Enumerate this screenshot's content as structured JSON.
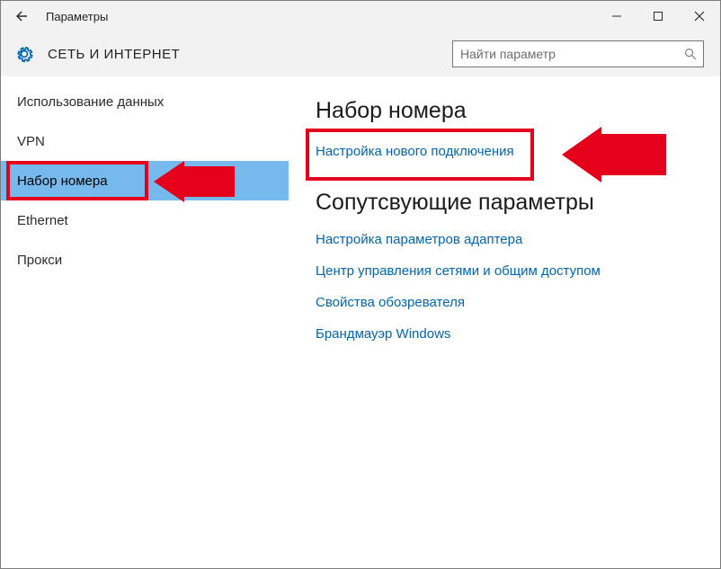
{
  "window": {
    "title": "Параметры"
  },
  "header": {
    "page_name": "СЕТЬ И ИНТЕРНЕТ",
    "search_placeholder": "Найти параметр"
  },
  "sidebar": {
    "items": [
      {
        "label": "Использование данных",
        "selected": false
      },
      {
        "label": "VPN",
        "selected": false
      },
      {
        "label": "Набор номера",
        "selected": true
      },
      {
        "label": "Ethernet",
        "selected": false
      },
      {
        "label": "Прокси",
        "selected": false
      }
    ]
  },
  "content": {
    "heading": "Набор номера",
    "primary_link": "Настройка нового подключения",
    "related_heading": "Сопутсвующие параметры",
    "related_links": [
      "Настройка параметров адаптера",
      "Центр управления сетями и общим доступом",
      "Свойства обозревателя",
      "Брандмауэр Windows"
    ]
  },
  "colors": {
    "link": "#0066b3",
    "highlight": "#e4001b",
    "selected_bg": "#76b9ed"
  }
}
